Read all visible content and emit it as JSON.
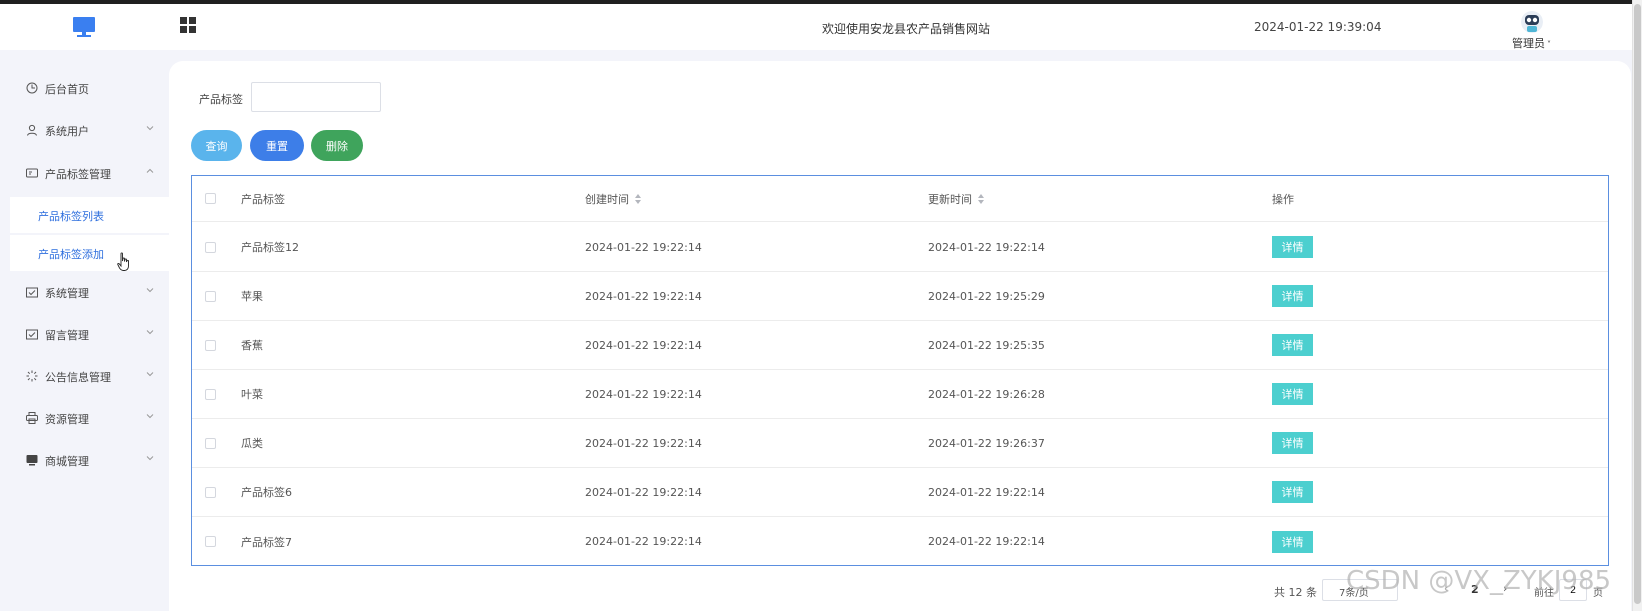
{
  "header": {
    "site_title": "欢迎使用安龙县农产品销售网站",
    "datetime": "2024-01-22 19:39:04",
    "user_name": "管理员",
    "user_caret": "˅"
  },
  "sidebar": {
    "items": [
      {
        "label": "后台首页",
        "icon": "clock-icon",
        "has_arrow": false
      },
      {
        "label": "系统用户",
        "icon": "user-icon",
        "has_arrow": true
      },
      {
        "label": "产品标签管理",
        "icon": "tag-card-icon",
        "has_arrow": true,
        "expanded": true
      },
      {
        "label": "系统管理",
        "icon": "folder-icon",
        "has_arrow": true
      },
      {
        "label": "留言管理",
        "icon": "folder-icon",
        "has_arrow": true
      },
      {
        "label": "公告信息管理",
        "icon": "loading-icon",
        "has_arrow": true
      },
      {
        "label": "资源管理",
        "icon": "printer-icon",
        "has_arrow": true
      },
      {
        "label": "商城管理",
        "icon": "monitor-icon",
        "has_arrow": true
      }
    ],
    "submenu": [
      {
        "label": "产品标签列表"
      },
      {
        "label": "产品标签添加"
      }
    ]
  },
  "filter": {
    "label": "产品标签",
    "value": "",
    "placeholder": ""
  },
  "actions": {
    "query": "查询",
    "reset": "重置",
    "delete": "删除"
  },
  "table": {
    "columns": {
      "tag": "产品标签",
      "created": "创建时间",
      "updated": "更新时间",
      "ops": "操作"
    },
    "rows": [
      {
        "tag": "产品标签12",
        "created": "2024-01-22 19:22:14",
        "updated": "2024-01-22 19:22:14",
        "action": "详情"
      },
      {
        "tag": "苹果",
        "created": "2024-01-22 19:22:14",
        "updated": "2024-01-22 19:25:29",
        "action": "详情"
      },
      {
        "tag": "香蕉",
        "created": "2024-01-22 19:22:14",
        "updated": "2024-01-22 19:25:35",
        "action": "详情"
      },
      {
        "tag": "叶菜",
        "created": "2024-01-22 19:22:14",
        "updated": "2024-01-22 19:26:28",
        "action": "详情"
      },
      {
        "tag": "瓜类",
        "created": "2024-01-22 19:22:14",
        "updated": "2024-01-22 19:26:37",
        "action": "详情"
      },
      {
        "tag": "产品标签6",
        "created": "2024-01-22 19:22:14",
        "updated": "2024-01-22 19:22:14",
        "action": "详情"
      },
      {
        "tag": "产品标签7",
        "created": "2024-01-22 19:22:14",
        "updated": "2024-01-22 19:22:14",
        "action": "详情"
      }
    ]
  },
  "pagination": {
    "total": "共 12 条",
    "page_size": "7条/页",
    "prev": "‹",
    "current_page": "2",
    "next": "›",
    "goto_label": "前往",
    "goto_value": "2",
    "page_word": "页"
  },
  "watermark": "CSDN @VX_ZYKJ985",
  "colors": {
    "query": "#5ab4ec",
    "reset": "#3d7ee8",
    "delete": "#3fa45c",
    "detail": "#4ccfcf",
    "submenu_text": "#2f6fde"
  }
}
